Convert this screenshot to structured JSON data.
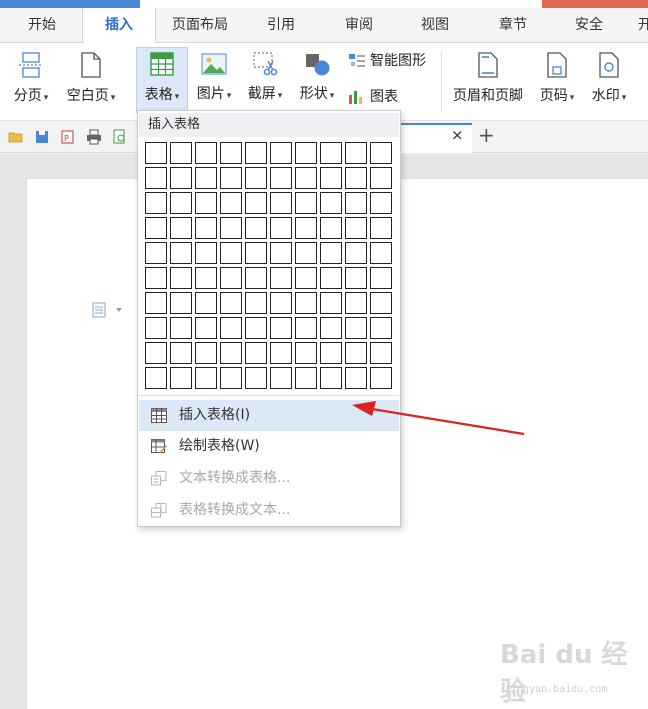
{
  "tabs": [
    {
      "label": "开始"
    },
    {
      "label": "插入",
      "active": true
    },
    {
      "label": "页面布局"
    },
    {
      "label": "引用"
    },
    {
      "label": "审阅"
    },
    {
      "label": "视图"
    },
    {
      "label": "章节"
    },
    {
      "label": "安全"
    },
    {
      "label": "开"
    }
  ],
  "ribbon": {
    "page_break": "分页",
    "blank_page": "空白页",
    "table": "表格",
    "picture": "图片",
    "screenshot": "截屏",
    "shape": "形状",
    "smart_art": "智能图形",
    "chart": "图表",
    "header_footer": "页眉和页脚",
    "page_number": "页码",
    "watermark": "水印"
  },
  "dropdown": {
    "header": "插入表格",
    "grid_rows": 10,
    "grid_cols": 10,
    "items": [
      {
        "label": "插入表格(I)",
        "state": "hover"
      },
      {
        "label": "绘制表格(W)",
        "state": "normal"
      },
      {
        "label": "文本转换成表格...",
        "state": "disabled"
      },
      {
        "label": "表格转换成文本...",
        "state": "disabled"
      }
    ]
  },
  "doc_tab": {
    "close": "×",
    "new": "+"
  },
  "watermark": {
    "brand": "Bai du 经验",
    "url": "jingyan.baidu.com"
  },
  "colors": {
    "accent": "#2b6fc9",
    "arrow": "#e0201e",
    "hover": "#dde8f6"
  }
}
